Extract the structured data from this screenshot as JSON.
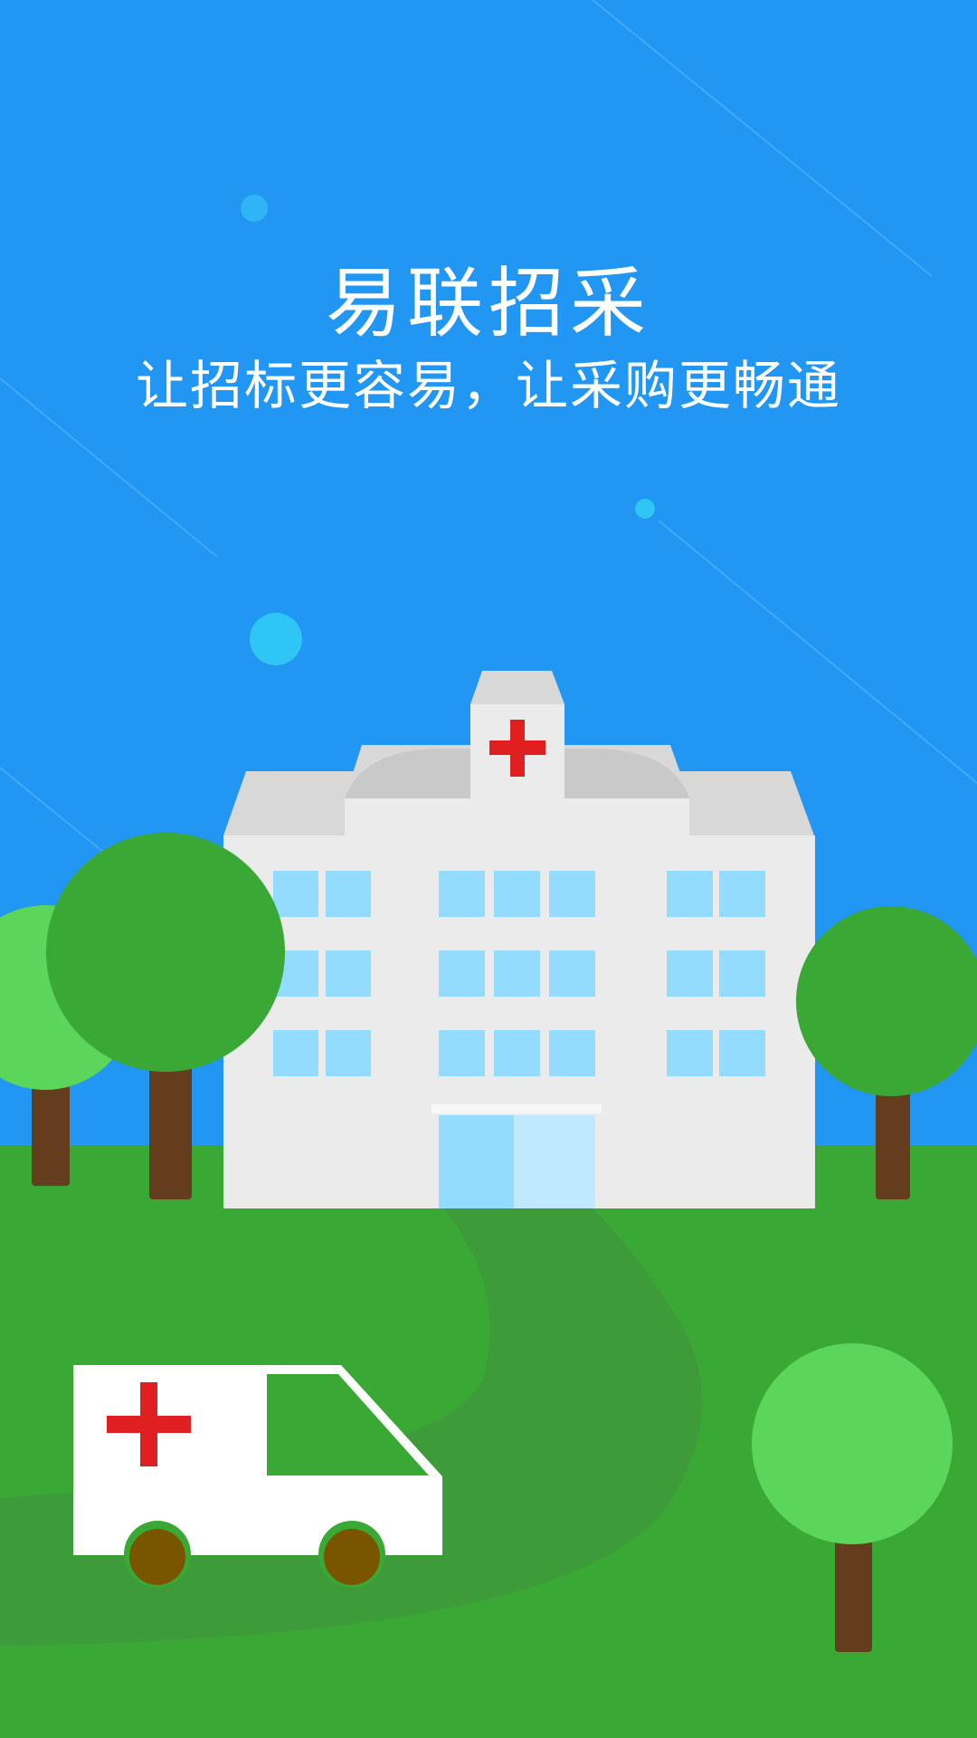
{
  "splash": {
    "title": "易联招采",
    "slogan": "让招标更容易，让采购更畅通"
  },
  "colors": {
    "sky": "#2196f3",
    "grass": "#3aa835",
    "path": "#3d9c39",
    "building": "#ebebeb",
    "roof": "#d8d8d8",
    "window": "#93dcff",
    "cross": "#e02020",
    "tree_dark": "#3aa835",
    "tree_light": "#5cd65a",
    "trunk": "#633d1e",
    "ambulance_body": "#ffffff",
    "wheel": "#7a5500"
  },
  "icons": {
    "hospital": "hospital-icon",
    "ambulance": "ambulance-icon",
    "cross": "red-cross-icon"
  }
}
